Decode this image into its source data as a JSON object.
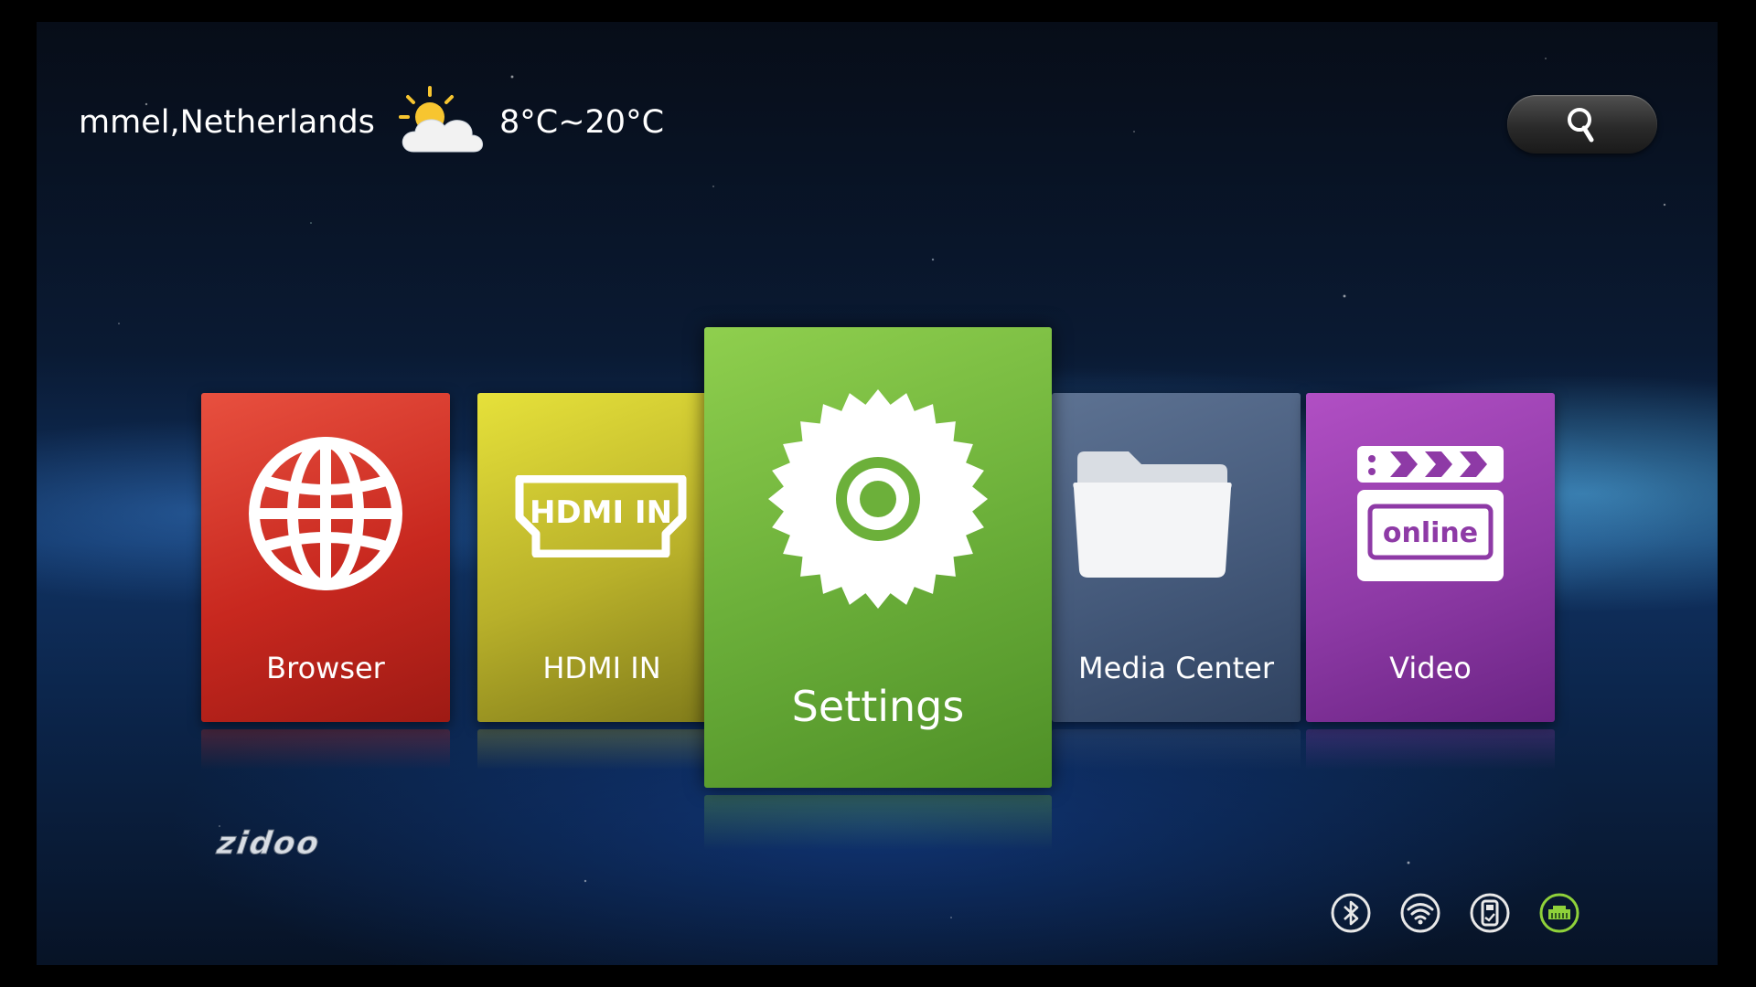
{
  "header": {
    "location": "mmel,Netherlands",
    "temperature": "8°C~20°C",
    "weather_icon": "partly-cloudy-icon"
  },
  "search": {
    "icon": "search-icon"
  },
  "tiles": [
    {
      "label": "Browser",
      "icon": "globe-icon",
      "color": "#c8281f"
    },
    {
      "label": "HDMI IN",
      "icon": "hdmi-port-icon",
      "icon_text": "HDMI IN",
      "color": "#b8b02a"
    },
    {
      "label": "Settings",
      "icon": "gear-icon",
      "color": "#6cb03a",
      "focused": true
    },
    {
      "label": "Media Center",
      "icon": "folder-icon",
      "color": "#44597a"
    },
    {
      "label": "Video",
      "icon": "clapperboard-icon",
      "icon_text": "online",
      "color": "#8e3aa6"
    }
  ],
  "brand": {
    "logo": "zidoo"
  },
  "status_bar": {
    "icons": [
      "bluetooth-icon",
      "wifi-icon",
      "usb-icon",
      "ethernet-icon"
    ],
    "active_color": "#8fd13a"
  }
}
